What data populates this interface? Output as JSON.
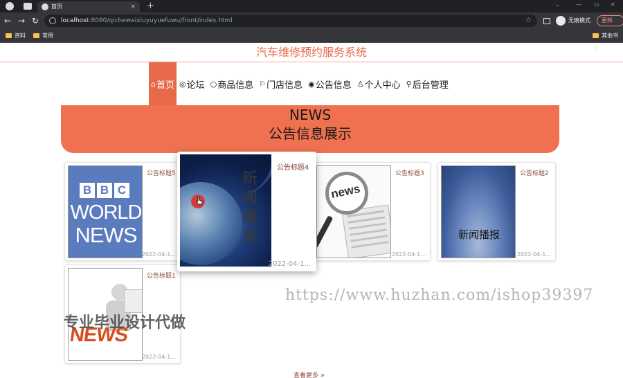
{
  "browser": {
    "tab_title": "首页",
    "tab_close": "×",
    "new_tab": "+",
    "url_host": "localhost",
    "url_rest": ":8080/qicheweixiuyuyuefuwu/front/index.html",
    "incognito_label": "无痕模式",
    "update_label": "更新",
    "bookmarks": [
      "资料",
      "常用"
    ],
    "other_bookmarks": "其他书签"
  },
  "site": {
    "title": "汽车维修预约服务系统"
  },
  "menu": [
    {
      "icon": "⌂",
      "label": "首页",
      "active": true
    },
    {
      "icon": "◎",
      "label": "论坛",
      "active": false
    },
    {
      "icon": "○",
      "label": "商品信息",
      "active": false
    },
    {
      "icon": "⚐",
      "label": "门店信息",
      "active": false
    },
    {
      "icon": "◉",
      "label": "公告信息",
      "active": false
    },
    {
      "icon": "♙",
      "label": "个人中心",
      "active": false
    },
    {
      "icon": "⚲",
      "label": "后台管理",
      "active": false
    }
  ],
  "banner": {
    "title_en": "NEWS",
    "title_cn": "公告信息展示"
  },
  "notices": [
    {
      "title": "公告标题5",
      "date": "2022-04-1...",
      "image": "bbc-world-news"
    },
    {
      "title": "公告标题4",
      "date": "2022-04-1...",
      "image": "globe-news",
      "image_text": "新闻播报"
    },
    {
      "title": "公告标题3",
      "date": "2022-04-1...",
      "image": "magnifier-news",
      "image_text": "news"
    },
    {
      "title": "公告标题2",
      "date": "2022-04-1...",
      "image": "sky-news",
      "image_text": "新闻播报"
    },
    {
      "title": "公告标题1",
      "date": "2022-04-1...",
      "image": "person-news",
      "image_text": "NEWS"
    }
  ],
  "bbc": {
    "box1": "B",
    "box2": "B",
    "box3": "C",
    "line1": "WORLD",
    "line2": "NEWS"
  },
  "more_label": "查看更多",
  "overlays": {
    "watermark_url": "https://www.huzhan.com/ishop39397",
    "watermark_cn": "专业毕业设计代做"
  },
  "colors": {
    "accent": "#ef7150",
    "title": "#e8684a",
    "chrome_dark": "#202124"
  }
}
